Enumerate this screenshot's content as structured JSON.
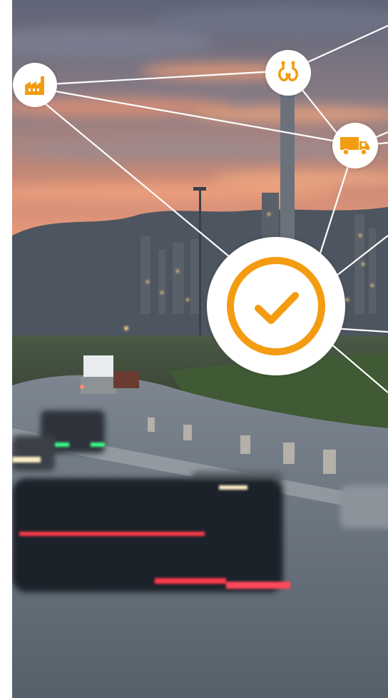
{
  "colors": {
    "accent": "#f39c12",
    "node_fill": "#ffffff",
    "connector": "#ffffff",
    "sky_top": "#6b7185",
    "sky_glow": "#e88f6a",
    "hills": "#4c5560",
    "road": "#5c6570"
  },
  "nodes": [
    {
      "name": "factory-node",
      "icon": "factory-icon"
    },
    {
      "name": "hook-node",
      "icon": "crane-hook-icon"
    },
    {
      "name": "truck-node",
      "icon": "truck-icon"
    },
    {
      "name": "checkmark-node",
      "icon": "checkmark-circle-icon"
    }
  ]
}
